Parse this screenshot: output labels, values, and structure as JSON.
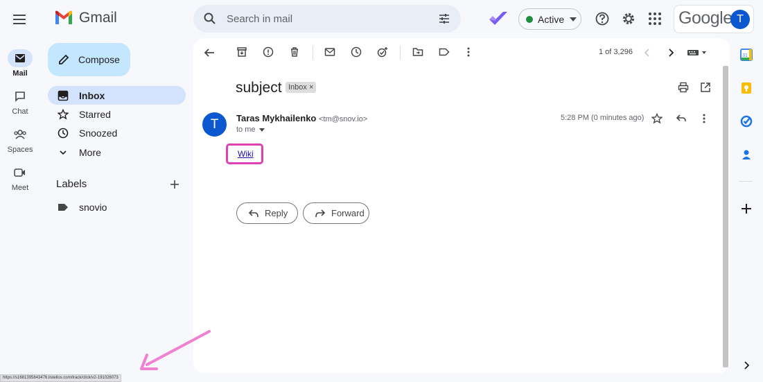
{
  "app": {
    "name": "Gmail"
  },
  "rail": [
    {
      "label": "Mail",
      "icon": "mail-icon",
      "active": true
    },
    {
      "label": "Chat",
      "icon": "chat-icon"
    },
    {
      "label": "Spaces",
      "icon": "spaces-icon"
    },
    {
      "label": "Meet",
      "icon": "meet-icon"
    }
  ],
  "search": {
    "placeholder": "Search in mail"
  },
  "status": {
    "label": "Active",
    "color": "#1e8e3e"
  },
  "account": {
    "brand": "Google",
    "initial": "T"
  },
  "compose": {
    "label": "Compose"
  },
  "nav": [
    {
      "label": "Inbox",
      "icon": "inbox-icon",
      "active": true
    },
    {
      "label": "Starred",
      "icon": "star-icon"
    },
    {
      "label": "Snoozed",
      "icon": "clock-icon"
    },
    {
      "label": "More",
      "icon": "chevron-down-icon"
    }
  ],
  "labels": {
    "heading": "Labels",
    "items": [
      {
        "label": "snovio"
      }
    ]
  },
  "toolbar": {
    "pager": "1 of 3,296"
  },
  "email": {
    "subject": "subject",
    "chip": "Inbox",
    "sender_name": "Taras Mykhailenko",
    "sender_email": "<tm@snov.io>",
    "avatar_initial": "T",
    "to": "to me",
    "time": "5:28 PM (0 minutes ago)",
    "link_text": "Wiki"
  },
  "actions": {
    "reply": "Reply",
    "forward": "Forward"
  },
  "statusbar": {
    "url": "https://s1681395843476.listellos.com/track/click/v2-191026073"
  },
  "colors": {
    "accent": "#0b57d0",
    "highlight": "#e040b5",
    "compose_bg": "#c2e7ff",
    "active_nav": "#d3e3fd"
  }
}
